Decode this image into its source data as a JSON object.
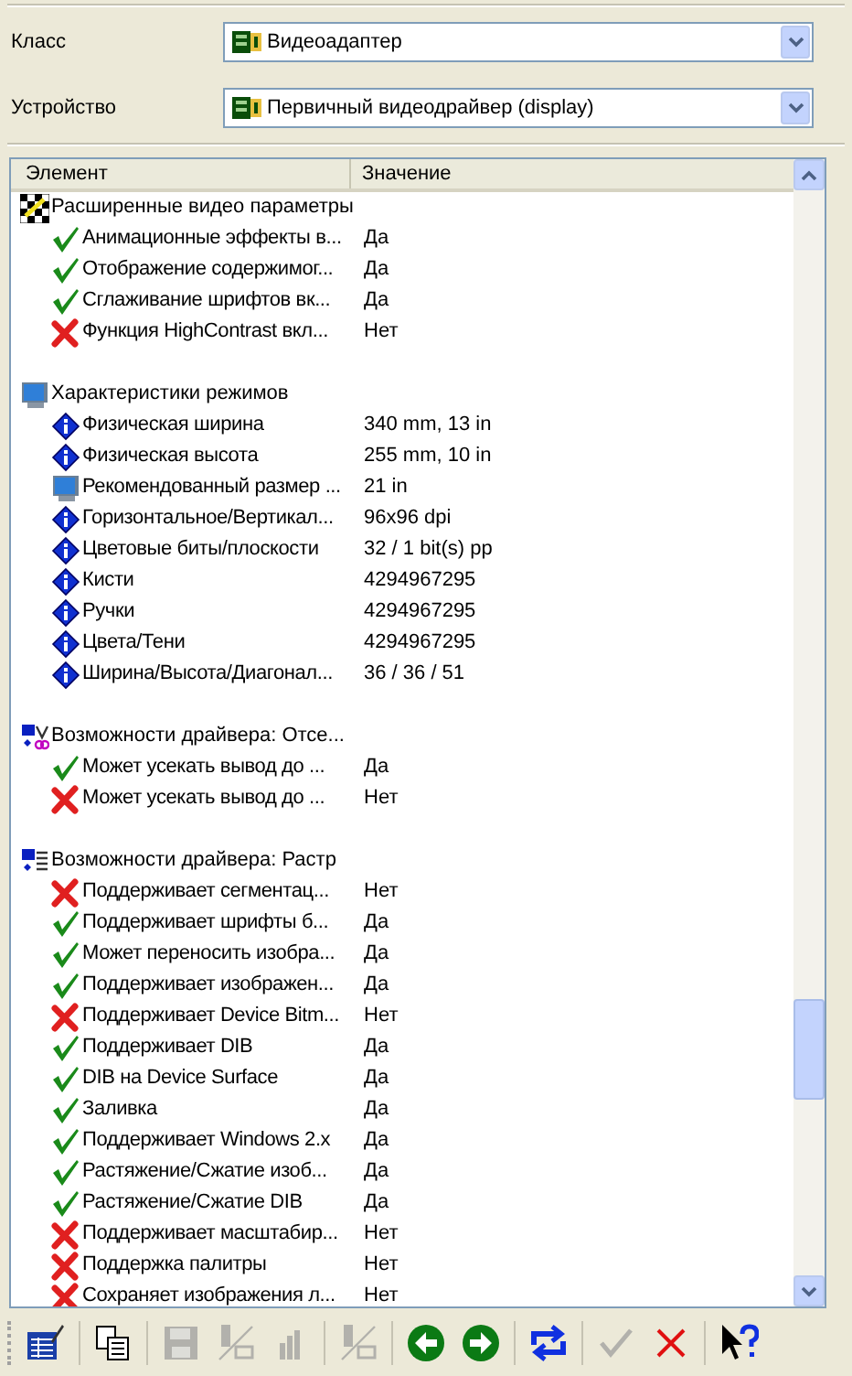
{
  "fields": [
    {
      "label": "Класс",
      "value": "Видеоадаптер"
    },
    {
      "label": "Устройство",
      "value": "Первичный видеодрайвер (display)"
    }
  ],
  "list": {
    "columns": [
      "Элемент",
      "Значение"
    ],
    "groups": [
      {
        "title": "Расширенные видео параметры",
        "kind": "checker",
        "items": [
          {
            "name": "Анимационные эффекты в...",
            "value": "Да",
            "kind": "check"
          },
          {
            "name": "Отображение содержимог...",
            "value": "Да",
            "kind": "check"
          },
          {
            "name": "Сглаживание шрифтов вк...",
            "value": "Да",
            "kind": "check"
          },
          {
            "name": "Функция HighContrast вкл...",
            "value": "Нет",
            "kind": "cross"
          }
        ]
      },
      {
        "title": "Характеристики режимов",
        "kind": "monitor",
        "items": [
          {
            "name": "Физическая ширина",
            "value": "340 mm, 13 in",
            "kind": "info"
          },
          {
            "name": "Физическая высота",
            "value": "255 mm, 10 in",
            "kind": "info"
          },
          {
            "name": "Рекомендованный размер ...",
            "value": "21 in",
            "kind": "monitor"
          },
          {
            "name": "Горизонтальное/Вертикал...",
            "value": "96x96 dpi",
            "kind": "info"
          },
          {
            "name": "Цветовые биты/плоскости",
            "value": "32 / 1 bit(s) pp",
            "kind": "info"
          },
          {
            "name": "Кисти",
            "value": "4294967295",
            "kind": "info"
          },
          {
            "name": "Ручки",
            "value": "4294967295",
            "kind": "info"
          },
          {
            "name": "Цвета/Тени",
            "value": "4294967295",
            "kind": "info"
          },
          {
            "name": "Ширина/Высота/Диагонал...",
            "value": "36 / 36 / 51",
            "kind": "info"
          }
        ]
      },
      {
        "title": "Возможности драйвера: Отсе...",
        "kind": "clip",
        "items": [
          {
            "name": "Может усекать вывод до ...",
            "value": "Да",
            "kind": "check"
          },
          {
            "name": "Может усекать вывод до ...",
            "value": "Нет",
            "kind": "cross"
          }
        ]
      },
      {
        "title": "Возможности драйвера: Растр",
        "kind": "raster",
        "items": [
          {
            "name": "Поддерживает сегментац...",
            "value": "Нет",
            "kind": "cross"
          },
          {
            "name": "Поддерживает шрифты б...",
            "value": "Да",
            "kind": "check"
          },
          {
            "name": "Может переносить изобра...",
            "value": "Да",
            "kind": "check"
          },
          {
            "name": "Поддерживает изображен...",
            "value": "Да",
            "kind": "check"
          },
          {
            "name": "Поддерживает Device Bitm...",
            "value": "Нет",
            "kind": "cross"
          },
          {
            "name": "Поддерживает DIB",
            "value": "Да",
            "kind": "check"
          },
          {
            "name": "DIB на Device Surface",
            "value": "Да",
            "kind": "check"
          },
          {
            "name": "Заливка",
            "value": "Да",
            "kind": "check"
          },
          {
            "name": "Поддерживает Windows 2.x",
            "value": "Да",
            "kind": "check"
          },
          {
            "name": "Растяжение/Сжатие изоб...",
            "value": "Да",
            "kind": "check"
          },
          {
            "name": "Растяжение/Сжатие DIB",
            "value": "Да",
            "kind": "check"
          },
          {
            "name": "Поддерживает масштабир...",
            "value": "Нет",
            "kind": "cross"
          },
          {
            "name": "Поддержка палитры",
            "value": "Нет",
            "kind": "cross"
          },
          {
            "name": "Сохраняет изображения л...",
            "value": "Нет",
            "kind": "cross"
          }
        ]
      }
    ]
  },
  "toolbar": [
    [
      {
        "kind": "properties",
        "disabled": false
      }
    ],
    [
      {
        "kind": "copy",
        "disabled": false
      }
    ],
    [
      {
        "kind": "save",
        "disabled": true
      },
      {
        "kind": "device",
        "disabled": true
      },
      {
        "kind": "bars",
        "disabled": true
      }
    ],
    [
      {
        "kind": "device",
        "disabled": true
      }
    ],
    [
      {
        "kind": "back",
        "disabled": false
      },
      {
        "kind": "forward",
        "disabled": false
      }
    ],
    [
      {
        "kind": "refresh",
        "disabled": false
      }
    ],
    [
      {
        "kind": "ok",
        "disabled": true
      },
      {
        "kind": "cancel",
        "disabled": false
      }
    ],
    [
      {
        "kind": "help",
        "disabled": false
      }
    ]
  ]
}
